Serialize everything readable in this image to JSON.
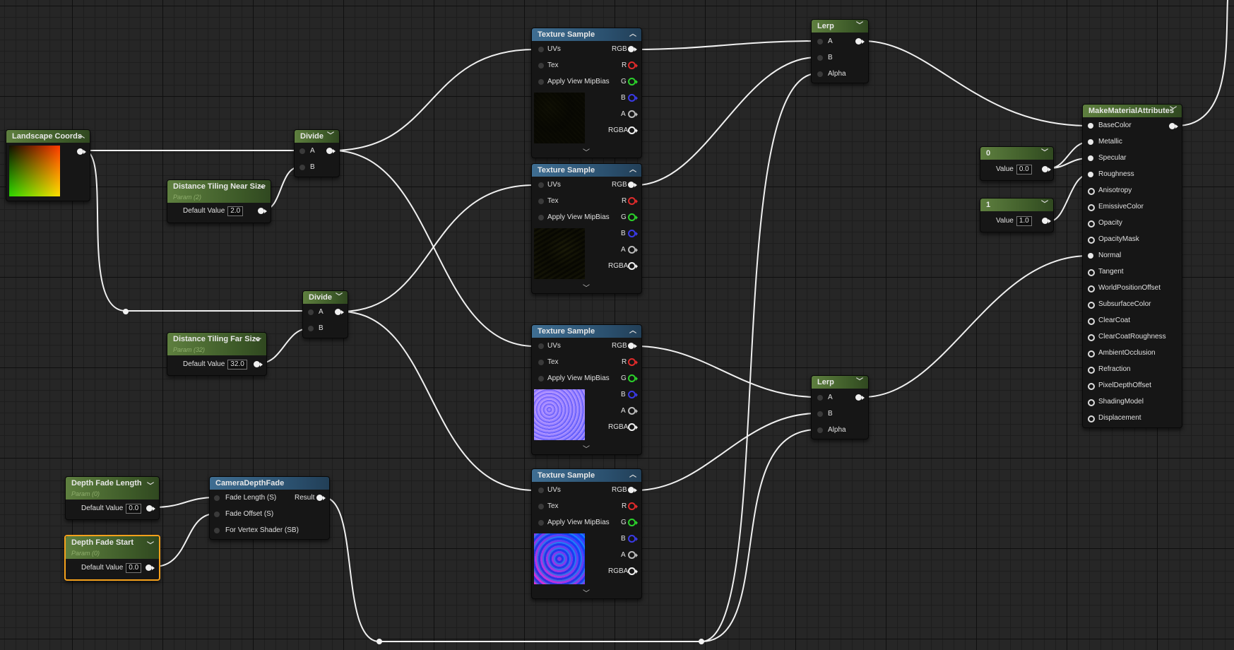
{
  "colors": {
    "header_green": "#4c6b31",
    "header_blue": "#2c5578",
    "selected_outline": "#f5a11c",
    "wire": "#f0f0f0"
  },
  "landscape_coords": {
    "title": "Landscape Coords"
  },
  "divide_top": {
    "title": "Divide",
    "pins": [
      "A",
      "B"
    ]
  },
  "divide_bottom": {
    "title": "Divide",
    "pins": [
      "A",
      "B"
    ]
  },
  "near_size": {
    "title": "Distance Tiling Near Size",
    "subtitle": "Param (2)",
    "label": "Default Value",
    "value": "2.0"
  },
  "far_size": {
    "title": "Distance Tiling Far Size",
    "subtitle": "Param (32)",
    "label": "Default Value",
    "value": "32.0"
  },
  "depth_fade_length": {
    "title": "Depth Fade Length",
    "subtitle": "Param (0)",
    "label": "Default Value",
    "value": "0.0"
  },
  "depth_fade_start": {
    "title": "Depth Fade Start",
    "subtitle": "Param (0)",
    "label": "Default Value",
    "value": "0.0"
  },
  "camera_depth_fade": {
    "title": "CameraDepthFade",
    "inputs": [
      "Fade Length (S)",
      "Fade Offset (S)",
      "For Vertex Shader (SB)"
    ],
    "output": "Result"
  },
  "texture_sample": {
    "title": "Texture Sample",
    "inputs": [
      "UVs",
      "Tex",
      "Apply View MipBias"
    ],
    "outputs": [
      "RGB",
      "R",
      "G",
      "B",
      "A",
      "RGBA"
    ],
    "output_colors": [
      "#f0f0f0",
      "#e02b2b",
      "#2bd12b",
      "#3a3ae6",
      "#bbbbbb",
      "#f0f0f0"
    ]
  },
  "lerp_top": {
    "title": "Lerp",
    "pins": [
      "A",
      "B",
      "Alpha"
    ]
  },
  "lerp_bottom": {
    "title": "Lerp",
    "pins": [
      "A",
      "B",
      "Alpha"
    ]
  },
  "const_0": {
    "title": "0",
    "label": "Value",
    "value": "0.0"
  },
  "const_1": {
    "title": "1",
    "label": "Value",
    "value": "1.0"
  },
  "make_material": {
    "title": "MakeMaterialAttributes",
    "inputs": [
      "BaseColor",
      "Metallic",
      "Specular",
      "Roughness",
      "Anisotropy",
      "EmissiveColor",
      "Opacity",
      "OpacityMask",
      "Normal",
      "Tangent",
      "WorldPositionOffset",
      "SubsurfaceColor",
      "ClearCoat",
      "ClearCoatRoughness",
      "AmbientOcclusion",
      "Refraction",
      "PixelDepthOffset",
      "ShadingModel",
      "Displacement"
    ],
    "connected_inputs": [
      "BaseColor",
      "Metallic",
      "Specular",
      "Roughness",
      "Normal"
    ]
  }
}
